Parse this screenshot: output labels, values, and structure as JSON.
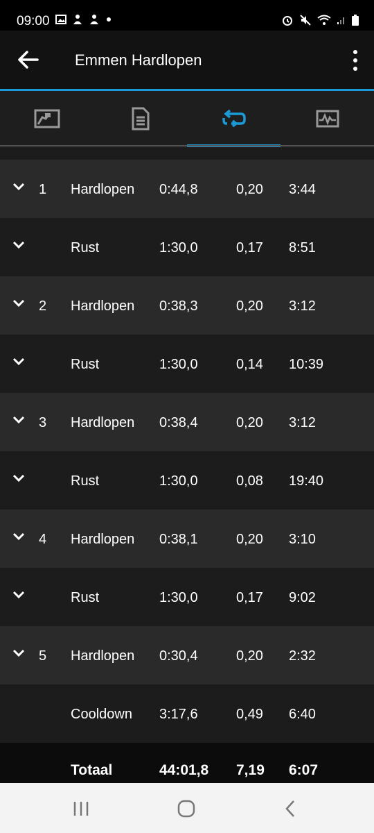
{
  "status": {
    "time": "09:00"
  },
  "app": {
    "title": "Emmen Hardlopen"
  },
  "tabs": [
    {
      "name": "map-tab",
      "icon": "map-icon"
    },
    {
      "name": "details-tab",
      "icon": "document-icon"
    },
    {
      "name": "laps-tab",
      "icon": "repeat-icon",
      "selected": true
    },
    {
      "name": "charts-tab",
      "icon": "chart-icon"
    }
  ],
  "laps": [
    {
      "num": "1",
      "type": "Hardlopen",
      "time": "0:44,8",
      "dist": "0,20",
      "pace": "3:44"
    },
    {
      "num": "",
      "type": "Rust",
      "time": "1:30,0",
      "dist": "0,17",
      "pace": "8:51"
    },
    {
      "num": "2",
      "type": "Hardlopen",
      "time": "0:38,3",
      "dist": "0,20",
      "pace": "3:12"
    },
    {
      "num": "",
      "type": "Rust",
      "time": "1:30,0",
      "dist": "0,14",
      "pace": "10:39"
    },
    {
      "num": "3",
      "type": "Hardlopen",
      "time": "0:38,4",
      "dist": "0,20",
      "pace": "3:12"
    },
    {
      "num": "",
      "type": "Rust",
      "time": "1:30,0",
      "dist": "0,08",
      "pace": "19:40"
    },
    {
      "num": "4",
      "type": "Hardlopen",
      "time": "0:38,1",
      "dist": "0,20",
      "pace": "3:10"
    },
    {
      "num": "",
      "type": "Rust",
      "time": "1:30,0",
      "dist": "0,17",
      "pace": "9:02"
    },
    {
      "num": "5",
      "type": "Hardlopen",
      "time": "0:30,4",
      "dist": "0,20",
      "pace": "2:32"
    },
    {
      "num": "",
      "type": "Cooldown",
      "time": "3:17,6",
      "dist": "0,49",
      "pace": "6:40"
    }
  ],
  "total": {
    "label": "Totaal",
    "time": "44:01,8",
    "dist": "7,19",
    "pace": "6:07"
  },
  "colors": {
    "accent": "#1b9ad8",
    "background": "#1c1c1c",
    "row_alt": "#2a2a2a"
  }
}
